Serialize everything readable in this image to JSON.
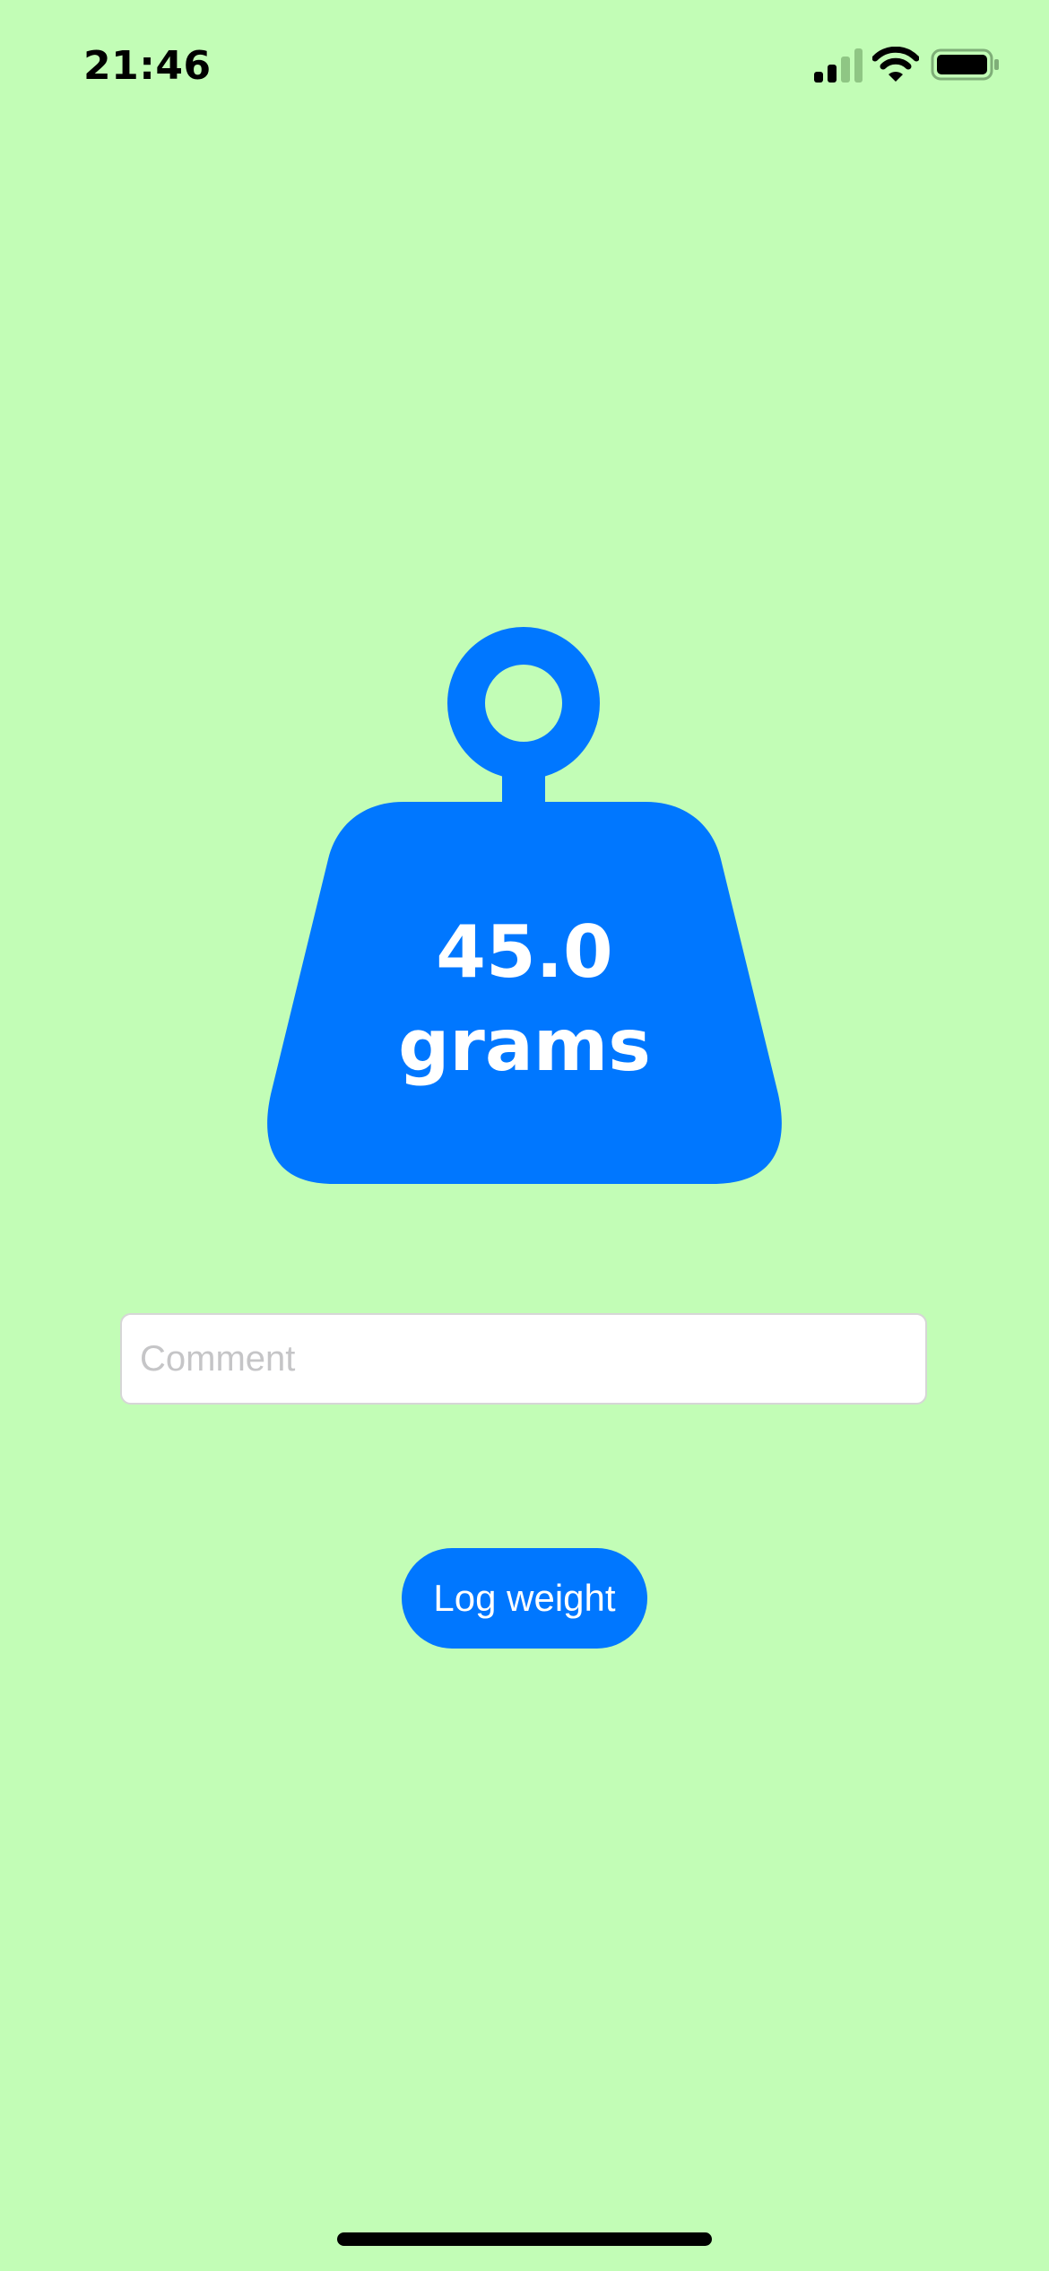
{
  "status_bar": {
    "time": "21:46"
  },
  "weight_display": {
    "value": "45.0",
    "unit": "grams",
    "icon": "weight-icon",
    "color": "#0077FF"
  },
  "comment": {
    "placeholder": "Comment",
    "value": ""
  },
  "log_button": {
    "label": "Log weight"
  },
  "colors": {
    "background": "#C2FDB6",
    "accent": "#0077FF"
  }
}
